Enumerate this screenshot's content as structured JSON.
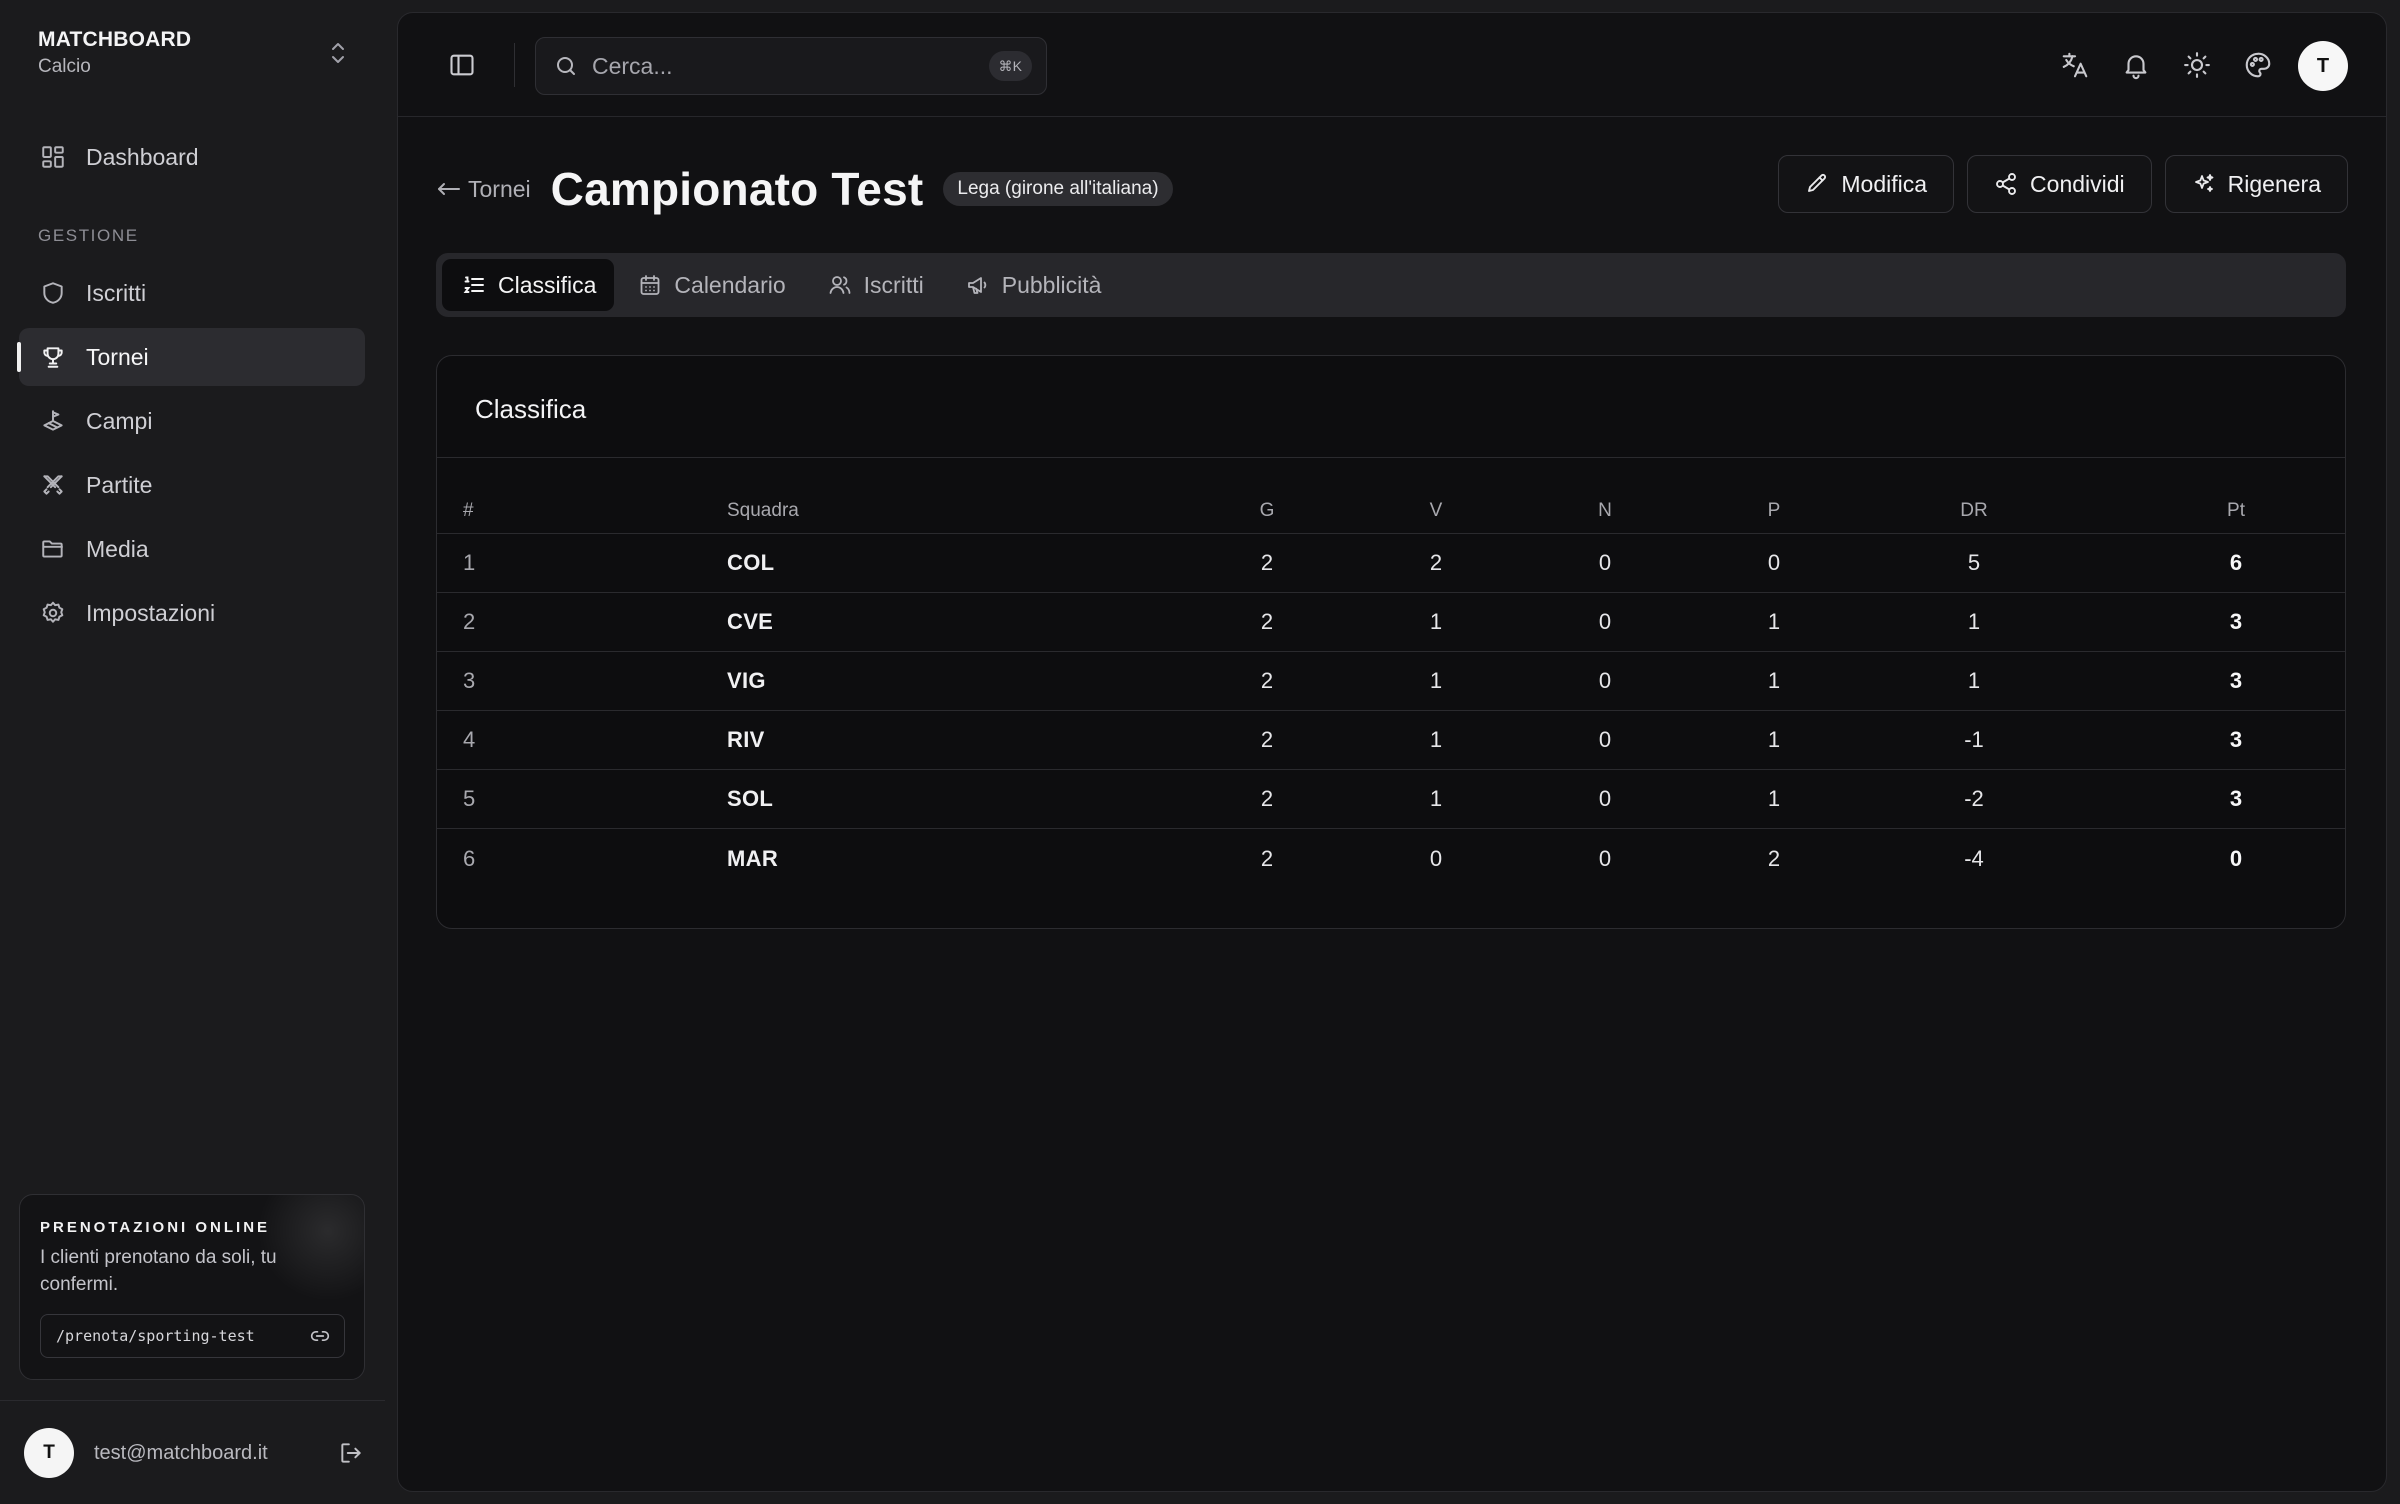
{
  "app": {
    "brand": "MATCHBOARD",
    "sport": "Calcio"
  },
  "sidebar": {
    "top_item": {
      "label": "Dashboard",
      "icon": "dashboard-icon"
    },
    "section_label": "GESTIONE",
    "items": [
      {
        "label": "Iscritti",
        "icon": "shield-icon"
      },
      {
        "label": "Tornei",
        "icon": "trophy-icon",
        "active": true
      },
      {
        "label": "Campi",
        "icon": "field-icon"
      },
      {
        "label": "Partite",
        "icon": "swords-icon"
      },
      {
        "label": "Media",
        "icon": "folder-icon"
      },
      {
        "label": "Impostazioni",
        "icon": "gear-icon"
      }
    ],
    "promo": {
      "title": "PRENOTAZIONI ONLINE",
      "text": "I clienti prenotano da soli, tu confermi.",
      "link": "/prenota/sporting-test"
    },
    "user": {
      "initial": "T",
      "email": "test@matchboard.it"
    }
  },
  "topbar": {
    "search": {
      "placeholder": "Cerca...",
      "shortcut": "⌘K"
    },
    "avatar_initial": "T",
    "icons": [
      "translate-icon",
      "bell-icon",
      "sun-icon",
      "palette-icon"
    ]
  },
  "header": {
    "back_label": "Tornei",
    "title": "Campionato Test",
    "badge": "Lega (girone all'italiana)",
    "actions": {
      "edit": "Modifica",
      "share": "Condividi",
      "regenerate": "Rigenera"
    }
  },
  "tabs": [
    {
      "label": "Classifica",
      "active": true
    },
    {
      "label": "Calendario"
    },
    {
      "label": "Iscritti"
    },
    {
      "label": "Pubblicità"
    }
  ],
  "standings": {
    "title": "Classifica",
    "columns": {
      "pos": "#",
      "team": "Squadra",
      "g": "G",
      "v": "V",
      "n": "N",
      "p": "P",
      "dr": "DR",
      "pt": "Pt"
    },
    "rows": [
      {
        "pos": "1",
        "team": "COL",
        "g": "2",
        "v": "2",
        "n": "0",
        "p": "0",
        "dr": "5",
        "pt": "6"
      },
      {
        "pos": "2",
        "team": "CVE",
        "g": "2",
        "v": "1",
        "n": "0",
        "p": "1",
        "dr": "1",
        "pt": "3"
      },
      {
        "pos": "3",
        "team": "VIG",
        "g": "2",
        "v": "1",
        "n": "0",
        "p": "1",
        "dr": "1",
        "pt": "3"
      },
      {
        "pos": "4",
        "team": "RIV",
        "g": "2",
        "v": "1",
        "n": "0",
        "p": "1",
        "dr": "-1",
        "pt": "3"
      },
      {
        "pos": "5",
        "team": "SOL",
        "g": "2",
        "v": "1",
        "n": "0",
        "p": "1",
        "dr": "-2",
        "pt": "3"
      },
      {
        "pos": "6",
        "team": "MAR",
        "g": "2",
        "v": "0",
        "n": "0",
        "p": "2",
        "dr": "-4",
        "pt": "0"
      }
    ]
  }
}
